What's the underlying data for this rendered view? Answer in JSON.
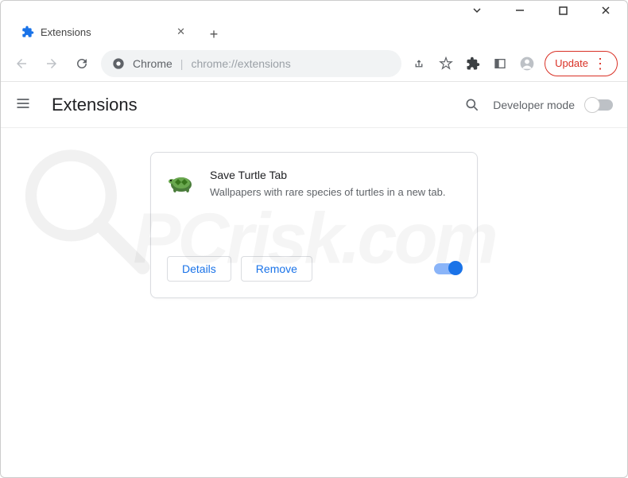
{
  "tab": {
    "title": "Extensions"
  },
  "omnibox": {
    "scheme": "Chrome",
    "url": "chrome://extensions"
  },
  "toolbar": {
    "update_label": "Update"
  },
  "page": {
    "title": "Extensions",
    "dev_mode_label": "Developer mode"
  },
  "extension": {
    "name": "Save Turtle Tab",
    "description": "Wallpapers with rare species of turtles in a new tab.",
    "details_label": "Details",
    "remove_label": "Remove"
  },
  "watermark": "PCrisk.com"
}
